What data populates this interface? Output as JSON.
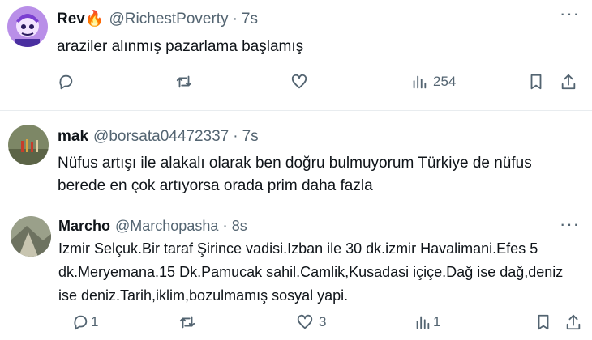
{
  "tweets": [
    {
      "name": "Rev🔥",
      "handle": "@RichestPoverty",
      "time": "7s",
      "text": "araziler alınmış pazarlama başlamış",
      "views": "254",
      "replies": "",
      "likes": ""
    },
    {
      "name": "mak",
      "handle": "@borsata04472337",
      "time": "7s",
      "text": "Nüfus artışı ile alakalı olarak ben doğru bulmuyorum Türkiye de nüfus berede en çok artıyorsa orada prim daha fazla"
    },
    {
      "name": "Marcho",
      "handle": "@Marchopasha",
      "time": "8s",
      "text": "Izmir Selçuk.Bir taraf Şirince vadisi.Izban ile 30 dk.izmir Havalimani.Efes 5 dk.Meryemana.15 Dk.Pamucak sahil.Camlik,Kusadasi içiçe.Dağ ise dağ,deniz ise deniz.Tarih,iklim,bozulmamış sosyal yapi.",
      "replies": "1",
      "likes": "3",
      "views": "1"
    }
  ],
  "icons": {
    "reply": "reply-icon",
    "retweet": "retweet-icon",
    "like": "heart-icon",
    "views": "views-chart-icon",
    "bookmark": "bookmark-icon",
    "share": "share-icon",
    "more": "more-dots-icon"
  },
  "colors": {
    "text": "#0f1419",
    "secondary": "#536471",
    "divider": "#e8ecef"
  }
}
